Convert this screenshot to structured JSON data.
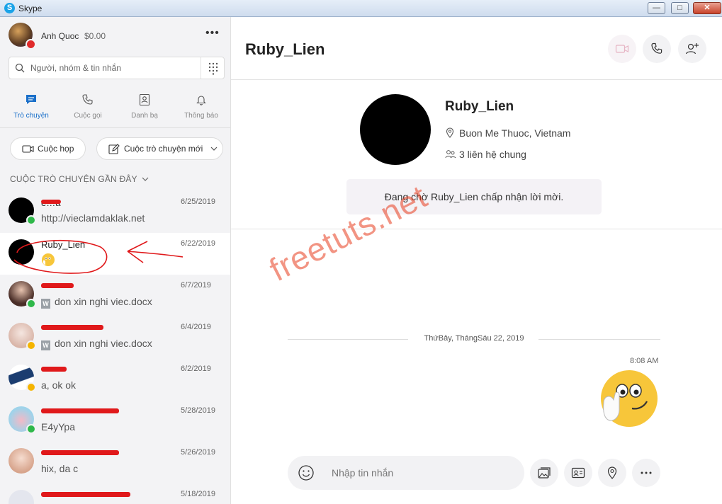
{
  "window": {
    "title": "Skype",
    "min": "—",
    "max": "□",
    "close": "✕"
  },
  "profile": {
    "name": "Anh Quoc",
    "credit": "$0.00",
    "more": "•••"
  },
  "search": {
    "placeholder": "Người, nhóm & tin nhắn"
  },
  "nav": {
    "tabs": [
      {
        "label": "Trò chuyện",
        "icon": "chat-icon",
        "active": true
      },
      {
        "label": "Cuộc gọi",
        "icon": "phone-icon"
      },
      {
        "label": "Danh bạ",
        "icon": "contacts-icon"
      },
      {
        "label": "Thông báo",
        "icon": "bell-icon"
      }
    ]
  },
  "actions": {
    "meet": "Cuộc họp",
    "new_chat": "Cuộc trò chuyện mới"
  },
  "recent": {
    "header": "CUỘC TRÒ CHUYỆN GẦN ĐÂY"
  },
  "chats": [
    {
      "name": "e…a",
      "date": "6/25/2019",
      "preview": "http://vieclamdaklak.net"
    },
    {
      "name": "Ruby_Lien",
      "date": "6/22/2019",
      "preview": ""
    },
    {
      "name": "",
      "date": "6/7/2019",
      "preview": "don xin nghi viec.docx"
    },
    {
      "name": "",
      "date": "6/4/2019",
      "preview": "don xin nghi viec.docx"
    },
    {
      "name": "",
      "date": "6/2/2019",
      "preview": "a, ok ok"
    },
    {
      "name": "",
      "date": "5/28/2019",
      "preview": "E4yYpa"
    },
    {
      "name": "",
      "date": "5/26/2019",
      "preview": "hix, da c"
    },
    {
      "name": "",
      "date": "5/18/2019",
      "preview": ""
    }
  ],
  "conversation": {
    "title": "Ruby_Lien",
    "profile_name": "Ruby_Lien",
    "location": "Buon Me Thuoc, Vietnam",
    "mutual": "3 liên hệ chung",
    "pending": "Đang chờ Ruby_Lien chấp nhận lời mời.",
    "date_separator": "ThứBảy, ThángSáu 22, 2019",
    "message_time": "8:08 AM",
    "composer_placeholder": "Nhập tin nhắn"
  },
  "watermark": "freetuts.net",
  "colors": {
    "accent": "#1a6fc9",
    "online": "#2fb84a",
    "away": "#f5b400",
    "dnd": "#e02b2b",
    "annotation": "#e0191b"
  }
}
